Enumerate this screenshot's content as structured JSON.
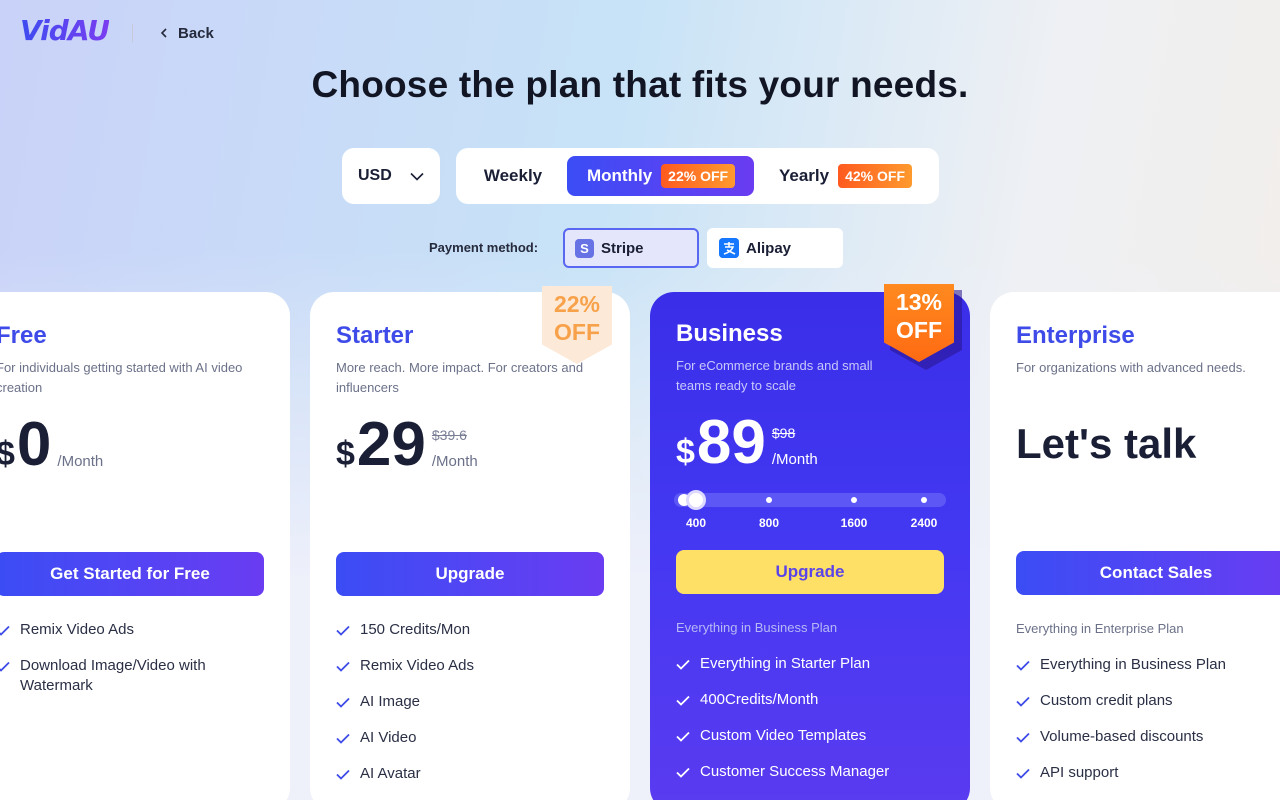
{
  "header": {
    "logo": "VidAU",
    "back_label": "Back"
  },
  "title": "Choose the plan that fits your needs.",
  "currency": {
    "selected": "USD"
  },
  "billing": {
    "weekly_label": "Weekly",
    "monthly_label": "Monthly",
    "monthly_badge": "22% OFF",
    "yearly_label": "Yearly",
    "yearly_badge": "42% OFF",
    "selected": "Monthly"
  },
  "payment": {
    "label": "Payment method:",
    "options": [
      "Stripe",
      "Alipay"
    ],
    "selected": "Stripe",
    "stripe_icon": "S"
  },
  "plans": {
    "free": {
      "name": "Free",
      "description": "For individuals getting started with AI video creation",
      "currency_symbol": "$",
      "price": "0",
      "period": "/Month",
      "cta": "Get Started for Free",
      "features": [
        "Remix Video Ads",
        "Download Image/Video with Watermark"
      ]
    },
    "starter": {
      "name": "Starter",
      "description": "More reach. More impact. For creators and influencers",
      "currency_symbol": "$",
      "price": "29",
      "old_price": "$39.6",
      "period": "/Month",
      "ribbon_line1": "22%",
      "ribbon_line2": "OFF",
      "cta": "Upgrade",
      "features": [
        "150 Credits/Mon",
        "Remix Video Ads",
        "AI Image",
        "AI Video",
        "AI Avatar"
      ]
    },
    "business": {
      "name": "Business",
      "description": "For eCommerce brands and small teams ready to scale",
      "currency_symbol": "$",
      "price": "89",
      "old_price": "$98",
      "period": "/Month",
      "ribbon_line1": "13%",
      "ribbon_line2": "OFF",
      "credit_options": [
        "400",
        "800",
        "1600",
        "2400"
      ],
      "credit_selected": "400",
      "cta": "Upgrade",
      "everything_label": "Everything in Business Plan",
      "features": [
        "Everything in Starter Plan",
        "400Credits/Month",
        "Custom Video Templates",
        "Customer Success Manager"
      ]
    },
    "enterprise": {
      "name": "Enterprise",
      "description": "For organizations with advanced needs.",
      "headline": "Let's talk",
      "cta": "Contact Sales",
      "everything_label": "Everything in Enterprise Plan",
      "features": [
        "Everything in Business Plan",
        "Custom credit plans",
        "Volume-based discounts",
        "API support"
      ]
    }
  },
  "colors": {
    "accent": "#3e4be8",
    "gradient_start": "#3b4df5",
    "gradient_end": "#6a3cf2",
    "business_cta": "#ffe066",
    "badge_orange": "#ff6a13"
  }
}
